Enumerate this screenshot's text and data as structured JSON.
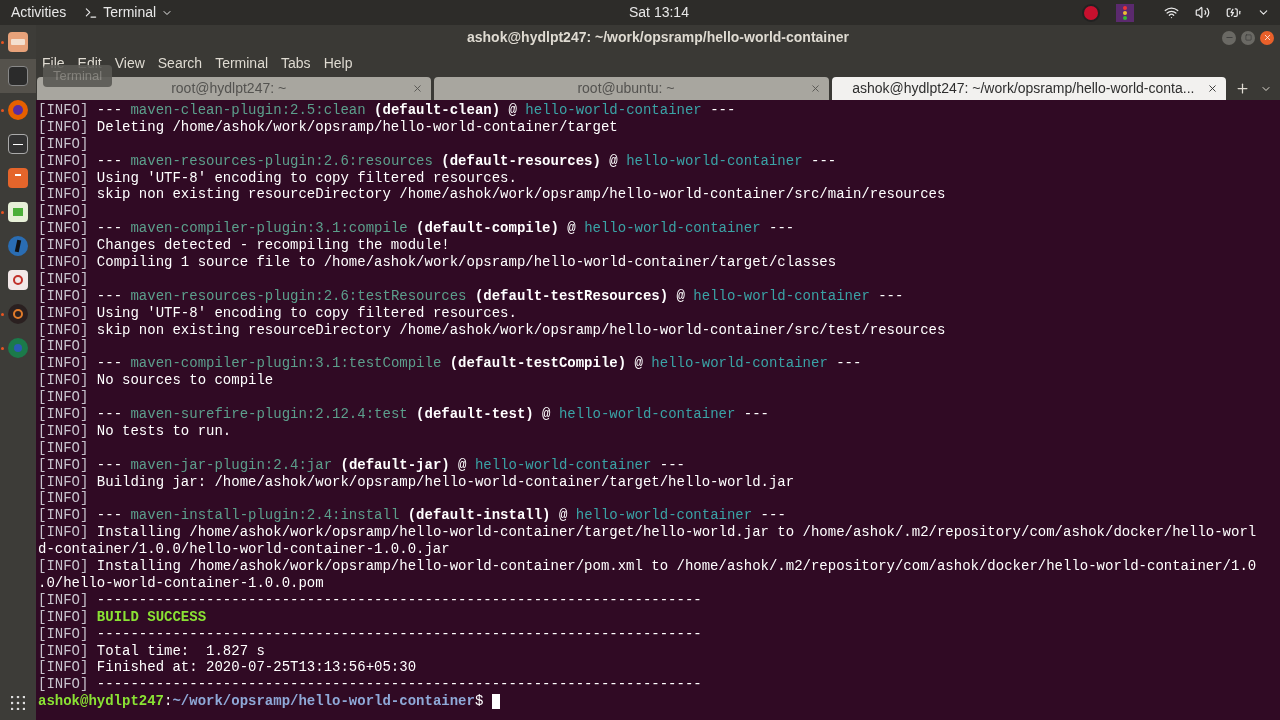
{
  "top_bar": {
    "activities": "Activities",
    "app_menu": "Terminal",
    "clock": "Sat 13:14"
  },
  "dock": {
    "tooltip": "Terminal"
  },
  "window": {
    "title": "ashok@hydlpt247: ~/work/opsramp/hello-world-container"
  },
  "menu": [
    "File",
    "Edit",
    "View",
    "Search",
    "Terminal",
    "Tabs",
    "Help"
  ],
  "tabs": [
    {
      "label": "root@hydlpt247: ~",
      "selected": false
    },
    {
      "label": "root@ubuntu: ~",
      "selected": false
    },
    {
      "label": "ashok@hydlpt247: ~/work/opsramp/hello-world-conta...",
      "selected": true
    }
  ],
  "terminal": {
    "lines": [
      [
        {
          "kind": "info",
          "text": "[INFO]"
        },
        {
          "kind": "text",
          "text": " --- "
        },
        {
          "kind": "plugin",
          "text": "maven-clean-plugin:2.5:clean"
        },
        {
          "kind": "goal",
          "text": " (default-clean)"
        },
        {
          "kind": "text",
          "text": " @ "
        },
        {
          "kind": "project",
          "text": "hello-world-container"
        },
        {
          "kind": "text",
          "text": " ---"
        }
      ],
      [
        {
          "kind": "info",
          "text": "[INFO]"
        },
        {
          "kind": "text",
          "text": " Deleting /home/ashok/work/opsramp/hello-world-container/target"
        }
      ],
      [
        {
          "kind": "info",
          "text": "[INFO]"
        }
      ],
      [
        {
          "kind": "info",
          "text": "[INFO]"
        },
        {
          "kind": "text",
          "text": " --- "
        },
        {
          "kind": "plugin",
          "text": "maven-resources-plugin:2.6:resources"
        },
        {
          "kind": "goal",
          "text": " (default-resources)"
        },
        {
          "kind": "text",
          "text": " @ "
        },
        {
          "kind": "project",
          "text": "hello-world-container"
        },
        {
          "kind": "text",
          "text": " ---"
        }
      ],
      [
        {
          "kind": "info",
          "text": "[INFO]"
        },
        {
          "kind": "text",
          "text": " Using 'UTF-8' encoding to copy filtered resources."
        }
      ],
      [
        {
          "kind": "info",
          "text": "[INFO]"
        },
        {
          "kind": "text",
          "text": " skip non existing resourceDirectory /home/ashok/work/opsramp/hello-world-container/src/main/resources"
        }
      ],
      [
        {
          "kind": "info",
          "text": "[INFO]"
        }
      ],
      [
        {
          "kind": "info",
          "text": "[INFO]"
        },
        {
          "kind": "text",
          "text": " --- "
        },
        {
          "kind": "plugin",
          "text": "maven-compiler-plugin:3.1:compile"
        },
        {
          "kind": "goal",
          "text": " (default-compile)"
        },
        {
          "kind": "text",
          "text": " @ "
        },
        {
          "kind": "project",
          "text": "hello-world-container"
        },
        {
          "kind": "text",
          "text": " ---"
        }
      ],
      [
        {
          "kind": "info",
          "text": "[INFO]"
        },
        {
          "kind": "text",
          "text": " Changes detected - recompiling the module!"
        }
      ],
      [
        {
          "kind": "info",
          "text": "[INFO]"
        },
        {
          "kind": "text",
          "text": " Compiling 1 source file to /home/ashok/work/opsramp/hello-world-container/target/classes"
        }
      ],
      [
        {
          "kind": "info",
          "text": "[INFO]"
        }
      ],
      [
        {
          "kind": "info",
          "text": "[INFO]"
        },
        {
          "kind": "text",
          "text": " --- "
        },
        {
          "kind": "plugin",
          "text": "maven-resources-plugin:2.6:testResources"
        },
        {
          "kind": "goal",
          "text": " (default-testResources)"
        },
        {
          "kind": "text",
          "text": " @ "
        },
        {
          "kind": "project",
          "text": "hello-world-container"
        },
        {
          "kind": "text",
          "text": " ---"
        }
      ],
      [
        {
          "kind": "info",
          "text": "[INFO]"
        },
        {
          "kind": "text",
          "text": " Using 'UTF-8' encoding to copy filtered resources."
        }
      ],
      [
        {
          "kind": "info",
          "text": "[INFO]"
        },
        {
          "kind": "text",
          "text": " skip non existing resourceDirectory /home/ashok/work/opsramp/hello-world-container/src/test/resources"
        }
      ],
      [
        {
          "kind": "info",
          "text": "[INFO]"
        }
      ],
      [
        {
          "kind": "info",
          "text": "[INFO]"
        },
        {
          "kind": "text",
          "text": " --- "
        },
        {
          "kind": "plugin",
          "text": "maven-compiler-plugin:3.1:testCompile"
        },
        {
          "kind": "goal",
          "text": " (default-testCompile)"
        },
        {
          "kind": "text",
          "text": " @ "
        },
        {
          "kind": "project",
          "text": "hello-world-container"
        },
        {
          "kind": "text",
          "text": " ---"
        }
      ],
      [
        {
          "kind": "info",
          "text": "[INFO]"
        },
        {
          "kind": "text",
          "text": " No sources to compile"
        }
      ],
      [
        {
          "kind": "info",
          "text": "[INFO]"
        }
      ],
      [
        {
          "kind": "info",
          "text": "[INFO]"
        },
        {
          "kind": "text",
          "text": " --- "
        },
        {
          "kind": "plugin",
          "text": "maven-surefire-plugin:2.12.4:test"
        },
        {
          "kind": "goal",
          "text": " (default-test)"
        },
        {
          "kind": "text",
          "text": " @ "
        },
        {
          "kind": "project",
          "text": "hello-world-container"
        },
        {
          "kind": "text",
          "text": " ---"
        }
      ],
      [
        {
          "kind": "info",
          "text": "[INFO]"
        },
        {
          "kind": "text",
          "text": " No tests to run."
        }
      ],
      [
        {
          "kind": "info",
          "text": "[INFO]"
        }
      ],
      [
        {
          "kind": "info",
          "text": "[INFO]"
        },
        {
          "kind": "text",
          "text": " --- "
        },
        {
          "kind": "plugin",
          "text": "maven-jar-plugin:2.4:jar"
        },
        {
          "kind": "goal",
          "text": " (default-jar)"
        },
        {
          "kind": "text",
          "text": " @ "
        },
        {
          "kind": "project",
          "text": "hello-world-container"
        },
        {
          "kind": "text",
          "text": " ---"
        }
      ],
      [
        {
          "kind": "info",
          "text": "[INFO]"
        },
        {
          "kind": "text",
          "text": " Building jar: /home/ashok/work/opsramp/hello-world-container/target/hello-world.jar"
        }
      ],
      [
        {
          "kind": "info",
          "text": "[INFO]"
        }
      ],
      [
        {
          "kind": "info",
          "text": "[INFO]"
        },
        {
          "kind": "text",
          "text": " --- "
        },
        {
          "kind": "plugin",
          "text": "maven-install-plugin:2.4:install"
        },
        {
          "kind": "goal",
          "text": " (default-install)"
        },
        {
          "kind": "text",
          "text": " @ "
        },
        {
          "kind": "project",
          "text": "hello-world-container"
        },
        {
          "kind": "text",
          "text": " ---"
        }
      ],
      [
        {
          "kind": "info",
          "text": "[INFO]"
        },
        {
          "kind": "text",
          "text": " Installing /home/ashok/work/opsramp/hello-world-container/target/hello-world.jar to /home/ashok/.m2/repository/com/ashok/docker/hello-worl"
        }
      ],
      [
        {
          "kind": "text",
          "text": "d-container/1.0.0/hello-world-container-1.0.0.jar"
        }
      ],
      [
        {
          "kind": "info",
          "text": "[INFO]"
        },
        {
          "kind": "text",
          "text": " Installing /home/ashok/work/opsramp/hello-world-container/pom.xml to /home/ashok/.m2/repository/com/ashok/docker/hello-world-container/1.0"
        }
      ],
      [
        {
          "kind": "text",
          "text": ".0/hello-world-container-1.0.0.pom"
        }
      ],
      [
        {
          "kind": "info",
          "text": "[INFO]"
        },
        {
          "kind": "text",
          "text": " ------------------------------------------------------------------------"
        }
      ],
      [
        {
          "kind": "info",
          "text": "[INFO]"
        },
        {
          "kind": "success",
          "text": " BUILD SUCCESS"
        }
      ],
      [
        {
          "kind": "info",
          "text": "[INFO]"
        },
        {
          "kind": "text",
          "text": " ------------------------------------------------------------------------"
        }
      ],
      [
        {
          "kind": "info",
          "text": "[INFO]"
        },
        {
          "kind": "text",
          "text": " Total time:  1.827 s"
        }
      ],
      [
        {
          "kind": "info",
          "text": "[INFO]"
        },
        {
          "kind": "text",
          "text": " Finished at: 2020-07-25T13:13:56+05:30"
        }
      ],
      [
        {
          "kind": "info",
          "text": "[INFO]"
        },
        {
          "kind": "text",
          "text": " ------------------------------------------------------------------------"
        }
      ],
      [
        {
          "kind": "user",
          "text": "ashok@hydlpt247"
        },
        {
          "kind": "text",
          "text": ":"
        },
        {
          "kind": "path",
          "text": "~/work/opsramp/hello-world-container"
        },
        {
          "kind": "text",
          "text": "$ "
        }
      ]
    ]
  }
}
